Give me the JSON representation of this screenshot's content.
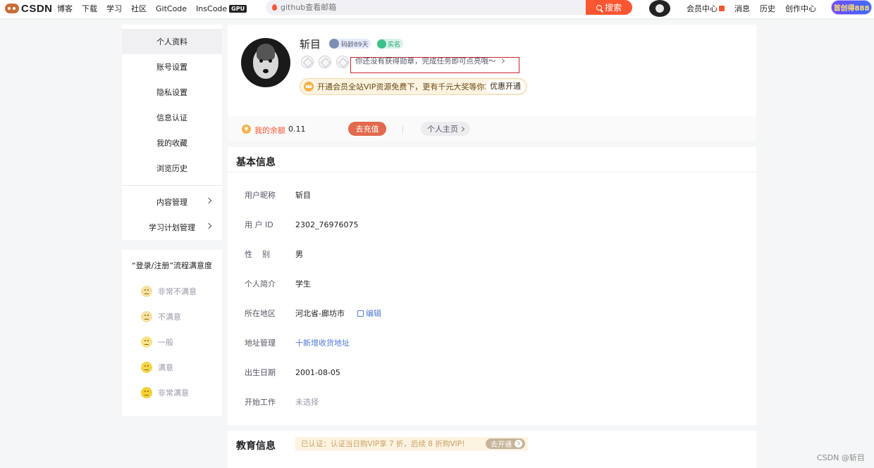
{
  "topnav": {
    "logo": "CSDN",
    "items": [
      "博客",
      "下载",
      "学习",
      "社区",
      "GitCode",
      "InsCode"
    ],
    "gpu_tag": "GPU",
    "search_placeholder": "github查看邮箱",
    "search_button": "搜索",
    "right_links": [
      "会员中心",
      "消息",
      "历史",
      "创作中心"
    ],
    "promo": "首创得888"
  },
  "sidebar": {
    "items": [
      {
        "label": "个人资料",
        "active": true
      },
      {
        "label": "账号设置"
      },
      {
        "label": "隐私设置"
      },
      {
        "label": "信息认证"
      },
      {
        "label": "我的收藏"
      },
      {
        "label": "浏览历史"
      },
      {
        "label": "内容管理",
        "has_chevron": true
      },
      {
        "label": "学习计划管理",
        "has_chevron": true
      }
    ]
  },
  "survey": {
    "title": "“登录/注册”流程满意度",
    "options": [
      {
        "label": "非常不满意",
        "color": "#f7e0a0"
      },
      {
        "label": "不满意",
        "color": "#f7e0a0"
      },
      {
        "label": "一般",
        "color": "#f8e28a"
      },
      {
        "label": "满意",
        "color": "#f5d54c"
      },
      {
        "label": "非常满意",
        "color": "#f5d032"
      }
    ]
  },
  "profile": {
    "name": "斩目",
    "code_age": "码龄89天",
    "verified": "实名",
    "medal_hint": "你还没有获得勋章，完成任务即可点亮哦～",
    "vip_text": "开通会员全站VIP资源免费下，更有千元大奖等你拿",
    "vip_button": "优惠开通"
  },
  "balance": {
    "label": "我的余额",
    "value": "0.11",
    "recharge": "去充值",
    "homepage": "个人主页"
  },
  "basic_info": {
    "title": "基本信息",
    "rows": [
      {
        "key": "用户昵称",
        "value": "斩目"
      },
      {
        "key": "用 户 ID",
        "value": "2302_76976075"
      },
      {
        "key": "性    别",
        "value": "男"
      },
      {
        "key": "个人简介",
        "value": "学生"
      },
      {
        "key": "所在地区",
        "value": "河北省-廊坊市",
        "action": "编辑"
      },
      {
        "key": "地址管理",
        "value": "十新增收货地址"
      },
      {
        "key": "出生日期",
        "value": "2001-08-05"
      },
      {
        "key": "开始工作",
        "value": "未选择"
      }
    ]
  },
  "education": {
    "title": "教育信息",
    "tip": "已认证：认证当日购VIP享 7 折，后续 8 折购VIP！",
    "button": "去开通"
  },
  "watermark": "CSDN @斩目",
  "colors": {
    "accent": "#fc5531",
    "link": "#4f7cd3",
    "highlight_box": "#c7262b"
  }
}
